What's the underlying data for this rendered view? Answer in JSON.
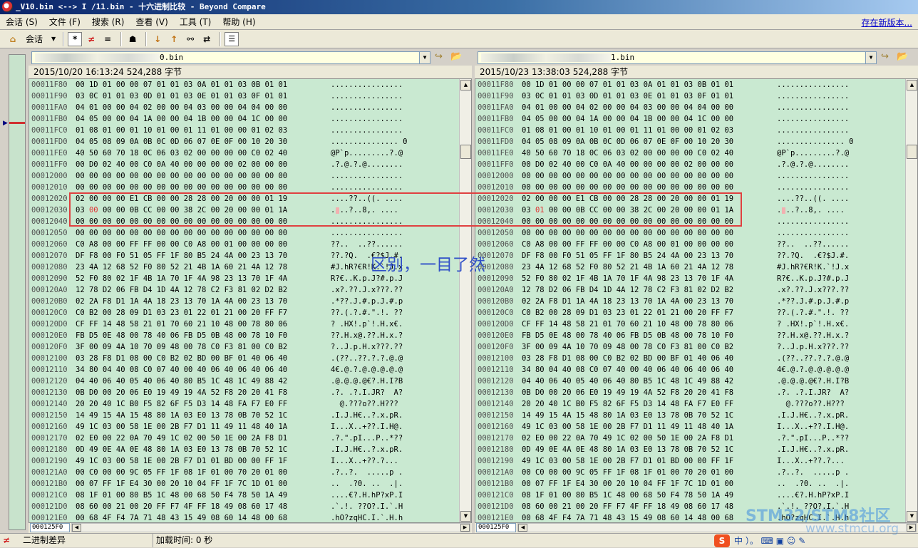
{
  "window": {
    "title": "_V10.bin <--> I        /11.bin - 十六进制比较 - Beyond Compare"
  },
  "menu": {
    "items": [
      "会话 (S)",
      "文件 (F)",
      "搜索 (R)",
      "查看 (V)",
      "工具 (T)",
      "帮助 (H)"
    ],
    "update_link": "存在新版本..."
  },
  "toolbar": {
    "session_label": "会话",
    "buttons": [
      "*",
      "≠",
      "="
    ]
  },
  "left": {
    "path": "0.bin",
    "info": "2015/10/20 16:13:24   524,288 字节",
    "position": "000125F0"
  },
  "right": {
    "path": "1.bin",
    "info": "2015/10/23 13:38:03   524,288 字节",
    "position": "000125F0"
  },
  "rows": [
    {
      "addr": "00011F80",
      "bytes": "00 1D 01 00 00 07 01 01 03 0A 01 01 03 0B 01 01",
      "ascii": "................"
    },
    {
      "addr": "00011F90",
      "bytes": "03 0C 01 01 03 0D 01 01 03 0E 01 01 03 0F 01 01",
      "ascii": "................"
    },
    {
      "addr": "00011FA0",
      "bytes": "04 01 00 00 04 02 00 00 04 03 00 00 04 04 00 00",
      "ascii": "................"
    },
    {
      "addr": "00011FB0",
      "bytes": "04 05 00 00 04 1A 00 00 04 1B 00 00 04 1C 00 00",
      "ascii": "................"
    },
    {
      "addr": "00011FC0",
      "bytes": "01 08 01 00 01 10 01 00 01 11 01 00 00 01 02 03",
      "ascii": "................"
    },
    {
      "addr": "00011FD0",
      "bytes": "04 05 08 09 0A 0B 0C 0D 06 07 0E 0F 00 10 20 30",
      "ascii": "............... 0"
    },
    {
      "addr": "00011FE0",
      "bytes": "40 50 60 70 18 0C 06 03 02 00 00 00 00 C0 02 40",
      "ascii": "@P`p.........?.@"
    },
    {
      "addr": "00011FF0",
      "bytes": "00 D0 02 40 00 C0 0A 40 00 00 00 00 02 00 00 00",
      "ascii": ".?.@.?.@........"
    },
    {
      "addr": "00012000",
      "bytes": "00 00 00 00 00 00 00 00 00 00 00 00 00 00 00 00",
      "ascii": "................"
    },
    {
      "addr": "00012010",
      "bytes": "00 00 00 00 00 00 00 00 00 00 00 00 00 00 00 00",
      "ascii": "................"
    },
    {
      "addr": "00012020",
      "bytes": "02 00 00 00 E1 CB 00 00 28 28 00 20 00 00 01 19",
      "ascii": "....??..((. ...."
    },
    {
      "addr": "00012030",
      "bytes": "03 00 00 00 0B CC 00 00 38 2C 00 20 00 00 01 1A",
      "ascii": "....?..8,. ...."
    },
    {
      "addr": "00012040",
      "bytes": "00 00 00 00 00 00 00 00 00 00 00 00 00 00 00 00",
      "ascii": "................"
    },
    {
      "addr": "00012050",
      "bytes": "00 00 00 00 00 00 00 00 00 00 00 00 00 00 00 00",
      "ascii": "................"
    },
    {
      "addr": "00012060",
      "bytes": "C0 A8 00 00 FF FF 00 00 C0 A8 00 01 00 00 00 00",
      "ascii": "??..  ..??......"
    },
    {
      "addr": "00012070",
      "bytes": "DF F8 00 F0 51 05 FF 1F 80 B5 24 4A 00 23 13 70",
      "ascii": "??.?Q.  .€?$J.#."
    },
    {
      "addr": "00012080",
      "bytes": "23 4A 12 68 52 F0 80 52 21 4B 1A 60 21 4A 12 78",
      "ascii": "#J.hR?€R!K.`!J.x"
    },
    {
      "addr": "00012090",
      "bytes": "52 F0 80 02 1F 4B 1A 70 1F 4A 98 23 13 70 1F 4A",
      "ascii": "R?€..K.p.J?#.p.J"
    },
    {
      "addr": "000120A0",
      "bytes": "12 78 D2 06 FB D4 1D 4A 12 78 C2 F3 81 02 D2 B2",
      "ascii": ".x?.??.J.x???.??"
    },
    {
      "addr": "000120B0",
      "bytes": "02 2A F8 D1 1A 4A 18 23 13 70 1A 4A 00 23 13 70",
      "ascii": ".*??.J.#.p.J.#.p"
    },
    {
      "addr": "000120C0",
      "bytes": "C0 B2 00 28 09 D1 03 23 01 22 01 21 00 20 FF F7",
      "ascii": "??.(.?.#.\".!. ??"
    },
    {
      "addr": "000120D0",
      "bytes": "CF FF 14 48 58 21 01 70 60 21 10 48 00 78 80 06",
      "ascii": "? .HX!.p`!.H.x€."
    },
    {
      "addr": "000120E0",
      "bytes": "FB D5 0E 48 00 78 40 06 FB D5 0B 48 00 78 10 F0",
      "ascii": "??.H.x@.??.H.x.?"
    },
    {
      "addr": "000120F0",
      "bytes": "3F 00 09 4A 10 70 09 48 00 78 C0 F3 81 00 C0 B2",
      "ascii": "?..J.p.H.x???.??"
    },
    {
      "addr": "00012100",
      "bytes": "03 28 F8 D1 08 00 C0 B2 02 BD 00 BF 01 40 06 40",
      "ascii": ".(??..??.?.?.@.@"
    },
    {
      "addr": "00012110",
      "bytes": "34 80 04 40 08 C0 07 40 00 40 06 40 06 40 06 40",
      "ascii": "4€.@.?.@.@.@.@.@"
    },
    {
      "addr": "00012120",
      "bytes": "04 40 06 40 05 40 06 40 80 B5 1C 48 1C 49 88 42",
      "ascii": ".@.@.@.@€?.H.I?B"
    },
    {
      "addr": "00012130",
      "bytes": "0B D0 00 20 06 E0 19 49 19 4A 52 F8 20 20 41 F8",
      "ascii": ".?. .?.I.JR?  A?"
    },
    {
      "addr": "00012140",
      "bytes": "20 20 40 1C B0 F5 82 6F F5 D3 14 48 FA F7 E0 FF",
      "ascii": "  @.???o??.H???"
    },
    {
      "addr": "00012150",
      "bytes": "14 49 15 4A 15 48 80 1A 03 E0 13 78 0B 70 52 1C",
      "ascii": ".I.J.H€..?.x.pR."
    },
    {
      "addr": "00012160",
      "bytes": "49 1C 03 00 58 1E 00 2B F7 D1 11 49 11 48 40 1A",
      "ascii": "I...X..+??.I.H@."
    },
    {
      "addr": "00012170",
      "bytes": "02 E0 00 22 0A 70 49 1C 02 00 50 1E 00 2A F8 D1",
      "ascii": ".?.\".pI...P..*??"
    },
    {
      "addr": "00012180",
      "bytes": "0D 49 0E 4A 0E 48 80 1A 03 E0 13 78 0B 70 52 1C",
      "ascii": ".I.J.H€..?.x.pR."
    },
    {
      "addr": "00012190",
      "bytes": "49 1C 03 00 58 1E 00 2B F7 D1 01 BD 00 00 FF 1F",
      "ascii": "I...X..+??.?..."
    },
    {
      "addr": "000121A0",
      "bytes": "00 C0 00 00 9C 05 FF 1F 08 1F 01 00 70 20 01 00",
      "ascii": ".?..?.  .....p ."
    },
    {
      "addr": "000121B0",
      "bytes": "00 07 FF 1F E4 30 00 20 10 04 FF 1F 7C 1D 01 00",
      "ascii": "..  .?0. ..  .|."
    },
    {
      "addr": "000121C0",
      "bytes": "08 1F 01 00 80 B5 1C 48 00 68 50 F4 78 50 1A 49",
      "ascii": "....€?.H.hP?xP.I"
    },
    {
      "addr": "000121D0",
      "bytes": "08 60 00 21 00 20 FF F7 4F FF 18 49 08 60 17 48",
      "ascii": ".`.!. ??O?.I.`.H"
    },
    {
      "addr": "000121E0",
      "bytes": "00 68 4F F4 7A 71 48 43 15 49 08 60 14 48 00 68",
      "ascii": ".hO?zqHC.I.`.H.h"
    }
  ],
  "right_row_overrides": {
    "11": {
      "bytes": "03 01 00 00 0B CC 00 00 38 2C 00 20 00 00 01 1A",
      "ascii": "....?..8,. ...."
    }
  },
  "annotation": "区别，一目了然",
  "status": {
    "mode": "二进制差异",
    "load_time": "加载时间: 0 秒"
  },
  "ime": {
    "logo": "S",
    "text": "中 ）。 ⌨ ▣ ☺ ✎"
  },
  "watermark": {
    "line1": "STM32/STM8社区",
    "line2": "www.stmcu.org"
  },
  "colors": {
    "hex_bg": "#c9e9d1",
    "diff_byte": "#e03030",
    "diff_frame": "#e04040",
    "annotation": "#3050c8"
  }
}
